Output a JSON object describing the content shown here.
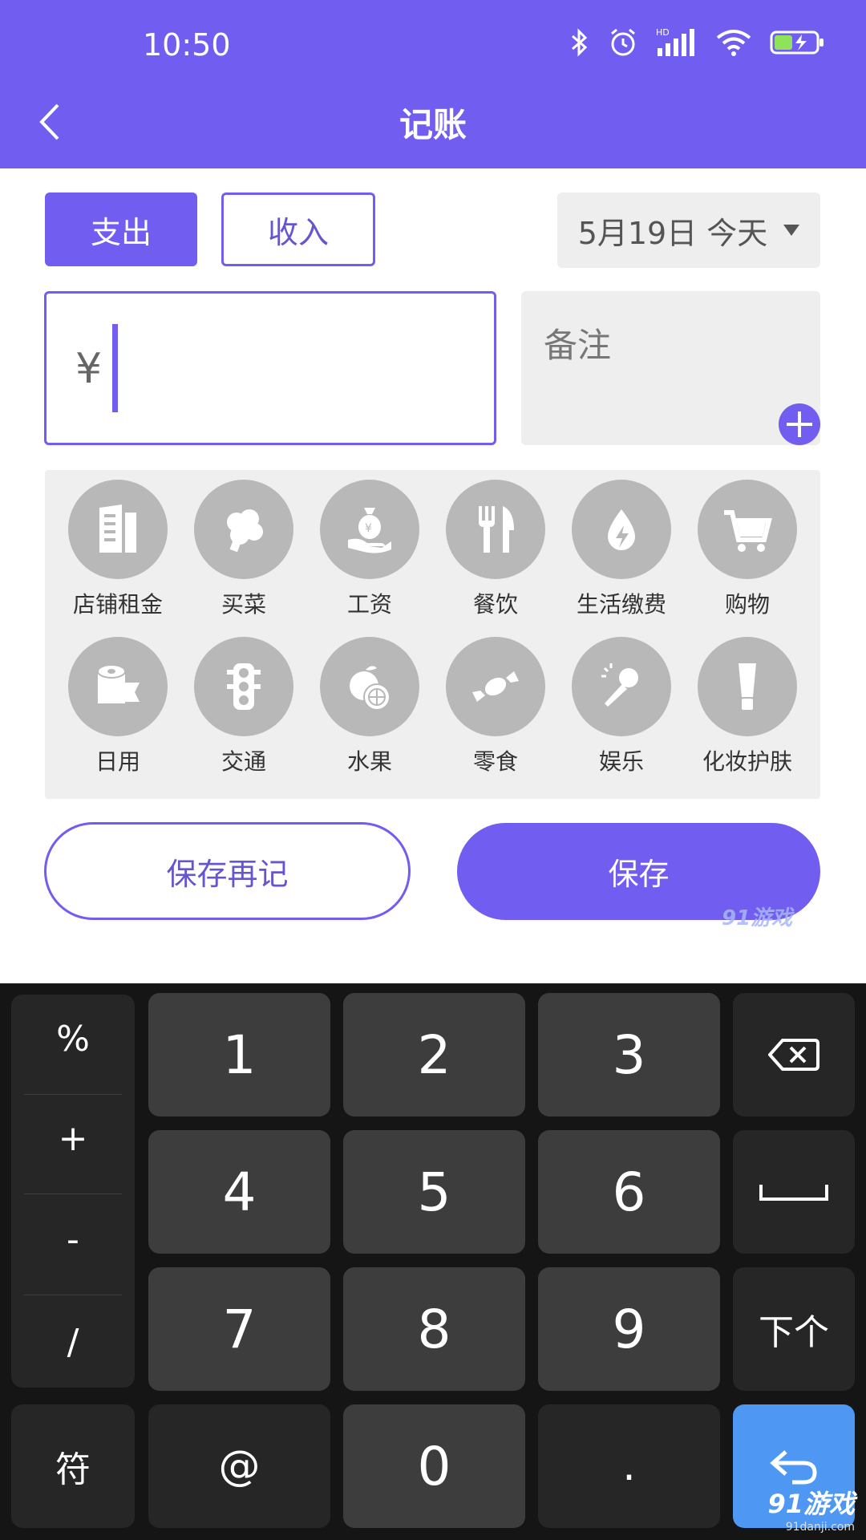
{
  "status_bar": {
    "time": "10:50"
  },
  "header": {
    "title": "记账"
  },
  "tabs": {
    "expense": "支出",
    "income": "收入"
  },
  "date_picker": {
    "value": "5月19日 今天"
  },
  "amount": {
    "currency": "¥",
    "value": ""
  },
  "note": {
    "placeholder": "备注"
  },
  "categories": [
    {
      "label": "店铺租金",
      "icon": "building-icon"
    },
    {
      "label": "买菜",
      "icon": "vegetable-icon"
    },
    {
      "label": "工资",
      "icon": "money-bag-icon"
    },
    {
      "label": "餐饮",
      "icon": "fork-knife-icon"
    },
    {
      "label": "生活缴费",
      "icon": "utility-drop-icon"
    },
    {
      "label": "购物",
      "icon": "cart-icon"
    },
    {
      "label": "日用",
      "icon": "toilet-paper-icon"
    },
    {
      "label": "交通",
      "icon": "traffic-light-icon"
    },
    {
      "label": "水果",
      "icon": "fruit-icon"
    },
    {
      "label": "零食",
      "icon": "candy-icon"
    },
    {
      "label": "娱乐",
      "icon": "microphone-icon"
    },
    {
      "label": "化妆护肤",
      "icon": "cosmetics-tube-icon"
    }
  ],
  "actions": {
    "save_again": "保存再记",
    "save": "保存"
  },
  "watermark": {
    "small": "91游戏",
    "main": "91游戏",
    "sub": "91danji.com"
  },
  "keyboard": {
    "symbols": [
      "%",
      "+",
      "-",
      "/"
    ],
    "digits": [
      "1",
      "2",
      "3",
      "4",
      "5",
      "6",
      "7",
      "8",
      "9"
    ],
    "next": "下个",
    "sym_toggle": "符",
    "at": "@",
    "zero": "0",
    "dot": "."
  },
  "colors": {
    "accent": "#715df0",
    "keyboard_bg": "#151515",
    "enter_key": "#4e98f4"
  }
}
